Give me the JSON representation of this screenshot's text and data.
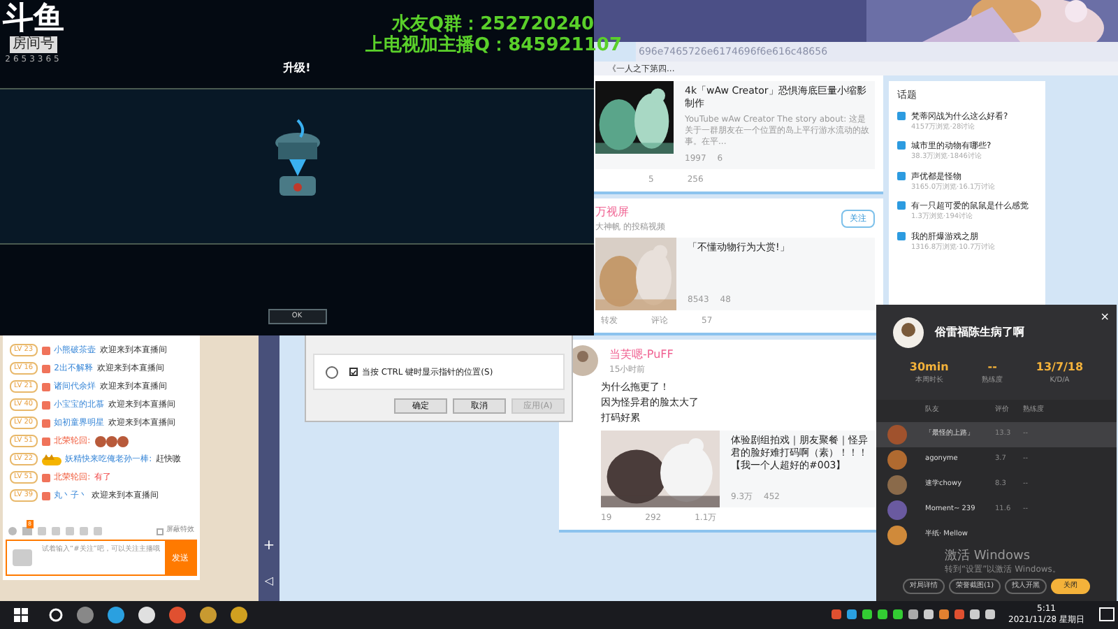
{
  "browser": {
    "address": "696e7465726e6174696f6e616c48656",
    "bookmarks": [
      "《一人之下第四..."
    ],
    "nav_icons": [
      "+",
      "◁"
    ],
    "posts": [
      {
        "kind": "video",
        "video_title": "4k「wAw Creator」恐惧海底巨量小缩影制作",
        "video_desc": "YouTube wAw Creator The story about: 这是关于一群朋友在一个位置的岛上平行游水流动的故事。在平...",
        "plays": "1997",
        "danmaku": "6",
        "actions": [
          "5",
          "256"
        ]
      },
      {
        "kind": "repost",
        "header": "万视屏",
        "meta": "大神帆 的投稿视频",
        "follow": "关注",
        "video_title": "「不懂动物行为大赏!」",
        "plays": "8543",
        "danmaku": "48",
        "actions": [
          "转发",
          "评论",
          "57"
        ]
      },
      {
        "kind": "post",
        "header": "当芙嗯-PuFF",
        "meta": "15小时前",
        "text": [
          "为什么拖更了！",
          "因为怪异君的脸太大了",
          "打码好累"
        ],
        "video_title": "体验剧组拍戏｜朋友聚餐｜怪异君的脸好难打码啊（素）！！！【我一个人超好的#003】",
        "plays": "9.3万",
        "danmaku": "452",
        "actions": [
          "19",
          "292",
          "1.1万"
        ]
      }
    ],
    "topics_title": "话题",
    "topics": [
      {
        "title": "梵蒂冈战为什么这么好看?",
        "stats": "4157万浏览·28讨论"
      },
      {
        "title": "城市里的动物有哪些?",
        "stats": "38.3万浏览·1846讨论"
      },
      {
        "title": "声优都是怪物",
        "stats": "3165.0万浏览·16.1万讨论"
      },
      {
        "title": "有一只超可爱的鼠鼠是什么感觉",
        "stats": "1.3万浏览·194讨论"
      },
      {
        "title": "我的肝爆游戏之朋",
        "stats": "1316.8万浏览·10.7万讨论"
      }
    ]
  },
  "dialog": {
    "checkbox": {
      "label": "当按 CTRL 键时显示指针的位置(S)",
      "checked": true
    },
    "buttons": [
      {
        "label": "确定",
        "disabled": false
      },
      {
        "label": "取消",
        "disabled": false
      },
      {
        "label": "应用(A)",
        "disabled": true
      }
    ]
  },
  "chat": {
    "messages": [
      {
        "level": "LV 23",
        "user": "小熊破茶壶",
        "text": "欢迎来到本直播间",
        "kind": "enter"
      },
      {
        "level": "LV 16",
        "user": "2出不解释",
        "text": "欢迎来到本直播间",
        "kind": "enter"
      },
      {
        "level": "LV 21",
        "user": "诸间代余烊",
        "text": "欢迎来到本直播间",
        "kind": "enter"
      },
      {
        "level": "LV 40",
        "user": "小宝宝的北慕",
        "text": "欢迎来到本直播间",
        "kind": "enter"
      },
      {
        "level": "LV 20",
        "user": "如初童界明星",
        "text": "欢迎来到本直播间",
        "kind": "enter"
      },
      {
        "level": "LV 51",
        "user": "北荣轮回:",
        "kind": "emoji"
      },
      {
        "level": "LV 22",
        "user": "妖精快来吃俺老孙一棒:",
        "text": "赶快嗷",
        "kind": "badge"
      },
      {
        "level": "LV 51",
        "user": "北荣轮回:",
        "text": "有了",
        "kind": "chat"
      },
      {
        "level": "LV 39",
        "user": "丸丶子丶",
        "text": "欢迎来到本直播间",
        "kind": "enter"
      }
    ],
    "mail_count": "8",
    "effects": {
      "label": "屏蔽特效",
      "checked": false
    },
    "placeholder": "试着输入“#关注”吧，可以关注主播哦",
    "send": "发送"
  },
  "game": {
    "logo": "斗鱼",
    "room_label": "房间号",
    "room_number": "2653365",
    "overlay": [
      "水友Q群：252720240",
      "上电视加主播Q：845921107"
    ],
    "title": "升级!",
    "ok": "OK"
  },
  "popup": {
    "close": "×",
    "name": "俗雷福陈生病了啊",
    "stats": [
      {
        "value": "30min",
        "label": "本周时长"
      },
      {
        "value": "--",
        "label": "熟练度"
      },
      {
        "value": "13/7/18",
        "label": "K/D/A"
      }
    ],
    "columns": [
      "队友",
      "评价",
      "熟练度"
    ],
    "rows": [
      {
        "name": "「最怪的上路」",
        "score": "13.3",
        "skill": "--",
        "selected": true
      },
      {
        "name": "agonyme",
        "score": "3.7",
        "skill": "--",
        "selected": false
      },
      {
        "name": "速学chowy",
        "score": "8.3",
        "skill": "--",
        "selected": false
      },
      {
        "name": "Moment~ 239",
        "score": "11.6",
        "skill": "--",
        "selected": false
      },
      {
        "name": "半纸· Mellow",
        "selected": false
      }
    ],
    "buttons": [
      {
        "label": "对局详情",
        "primary": false
      },
      {
        "label": "荣誉截图(1)",
        "primary": false
      },
      {
        "label": "找人开黑",
        "primary": false
      },
      {
        "label": "关闭",
        "primary": true
      }
    ]
  },
  "activation": [
    "激活 Windows",
    "转到“设置”以激活 Windows。"
  ],
  "clock": {
    "time": "5:11",
    "date": "2021/11/28 星期日"
  }
}
